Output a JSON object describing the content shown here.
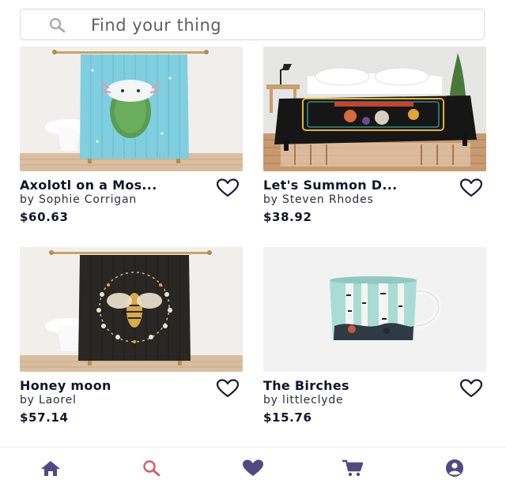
{
  "search": {
    "placeholder": "Find your thing",
    "icon": "search-icon"
  },
  "products": [
    {
      "title": "Axolotl on a Mos...",
      "artist": "by Sophie Corrigan",
      "price": "$60.63",
      "image": "shower-curtain-axolotl"
    },
    {
      "title": "Let's Summon D...",
      "artist": "by Steven Rhodes",
      "price": "$38.92",
      "image": "duvet-cover-summon"
    },
    {
      "title": "Honey moon",
      "artist": "by Laorel",
      "price": "$57.14",
      "image": "shower-curtain-bee"
    },
    {
      "title": "The Birches",
      "artist": "by littleclyde",
      "price": "$15.76",
      "image": "mug-birches"
    }
  ],
  "nav": [
    {
      "name": "home",
      "icon": "home-icon",
      "active": false
    },
    {
      "name": "search",
      "icon": "search-icon",
      "active": true
    },
    {
      "name": "favorites",
      "icon": "heart-icon",
      "active": false
    },
    {
      "name": "cart",
      "icon": "cart-icon",
      "active": false
    },
    {
      "name": "account",
      "icon": "account-icon",
      "active": false
    }
  ],
  "colors": {
    "nav_inactive": "#4f4a82",
    "nav_active": "#d65a6b",
    "heart_outline": "#1b1b2f",
    "text_primary": "#14142a"
  }
}
